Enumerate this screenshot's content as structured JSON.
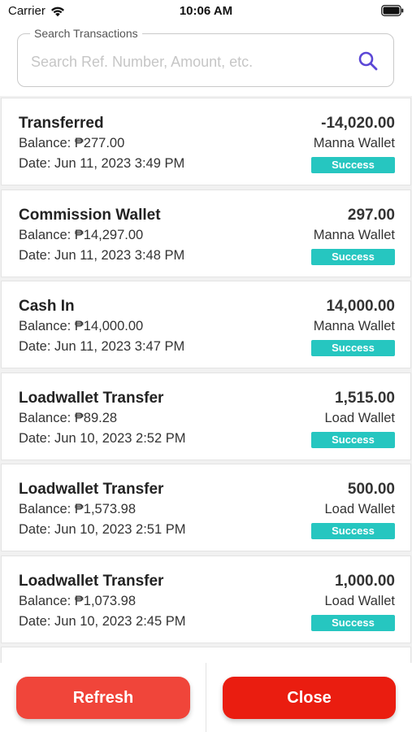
{
  "status_bar": {
    "carrier": "Carrier",
    "time": "10:06 AM"
  },
  "search": {
    "label": "Search Transactions",
    "placeholder": "Search Ref. Number, Amount, etc.",
    "value": "",
    "icon": "search-icon",
    "icon_color": "#5b47d6"
  },
  "transactions": [
    {
      "title": "Transferred",
      "balance": "Balance: ₱277.00",
      "date": "Date: Jun 11, 2023 3:49 PM",
      "amount": "-14,020.00",
      "wallet": "Manna Wallet",
      "status": "Success"
    },
    {
      "title": "Commission Wallet",
      "balance": "Balance: ₱14,297.00",
      "date": "Date: Jun 11, 2023 3:48 PM",
      "amount": "297.00",
      "wallet": "Manna Wallet",
      "status": "Success"
    },
    {
      "title": "Cash In",
      "balance": "Balance: ₱14,000.00",
      "date": "Date: Jun 11, 2023 3:47 PM",
      "amount": "14,000.00",
      "wallet": "Manna Wallet",
      "status": "Success"
    },
    {
      "title": "Loadwallet Transfer",
      "balance": "Balance: ₱89.28",
      "date": "Date: Jun 10, 2023 2:52 PM",
      "amount": "1,515.00",
      "wallet": "Load Wallet",
      "status": "Success"
    },
    {
      "title": "Loadwallet Transfer",
      "balance": "Balance: ₱1,573.98",
      "date": "Date: Jun 10, 2023 2:51 PM",
      "amount": "500.00",
      "wallet": "Load Wallet",
      "status": "Success"
    },
    {
      "title": "Loadwallet Transfer",
      "balance": "Balance: ₱1,073.98",
      "date": "Date: Jun 10, 2023 2:45 PM",
      "amount": "1,000.00",
      "wallet": "Load Wallet",
      "status": "Success"
    }
  ],
  "buttons": {
    "refresh_label": "Refresh",
    "close_label": "Close"
  },
  "colors": {
    "success_badge": "#26c6c0",
    "refresh_button": "#f0453a",
    "close_button": "#ea1d10"
  }
}
